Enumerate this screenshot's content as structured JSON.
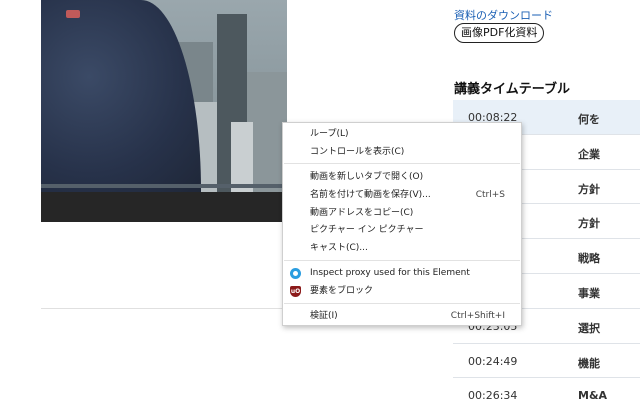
{
  "right_panel": {
    "download_link": "資料のダウンロード",
    "pdf_button": "画像PDF化資料",
    "schedule_title": "講義タイムテーブル",
    "rows": [
      {
        "time": "00:08:22",
        "desc": "何を"
      },
      {
        "time": "",
        "desc": "企業"
      },
      {
        "time": "",
        "desc": "方針"
      },
      {
        "time": "",
        "desc": "方針"
      },
      {
        "time": "",
        "desc": "戦略"
      },
      {
        "time": "",
        "desc": "事業"
      },
      {
        "time": "00:23:05",
        "desc": "選択"
      },
      {
        "time": "00:24:49",
        "desc": "機能"
      },
      {
        "time": "00:26:34",
        "desc": "M&A"
      }
    ]
  },
  "context_menu": {
    "items": [
      {
        "label": "ループ(L)",
        "shortcut": ""
      },
      {
        "label": "コントロールを表示(C)",
        "shortcut": ""
      },
      {
        "label": "動画を新しいタブで開く(O)",
        "shortcut": ""
      },
      {
        "label": "名前を付けて動画を保存(V)...",
        "shortcut": "Ctrl+S"
      },
      {
        "label": "動画アドレスをコピー(C)",
        "shortcut": ""
      },
      {
        "label": "ピクチャー イン ピクチャー",
        "shortcut": ""
      },
      {
        "label": "キャスト(C)...",
        "shortcut": ""
      },
      {
        "label": "Inspect proxy used for this Element",
        "shortcut": "",
        "icon": "proxy-icon"
      },
      {
        "label": "要素をブロック",
        "shortcut": "",
        "icon": "ublock-icon",
        "icon_text": "uO"
      },
      {
        "label": "検証(I)",
        "shortcut": "Ctrl+Shift+I"
      }
    ]
  },
  "colors": {
    "link": "#1a5fb4",
    "active_row": "#e8f0f8",
    "proxy_icon": "#2a9de0",
    "ublock_icon": "#8b1a1a"
  }
}
